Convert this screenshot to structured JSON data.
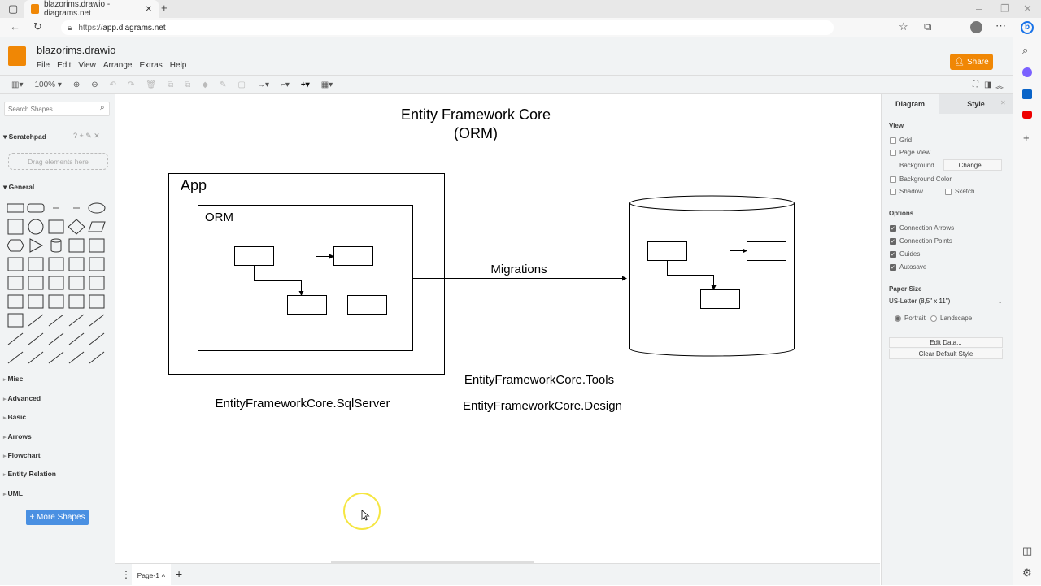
{
  "browser": {
    "tab_title": "blazorims.drawio - diagrams.net",
    "url_prefix": "https://",
    "url_host": "app.diagrams.net"
  },
  "app": {
    "title": "blazorims.drawio",
    "menu": [
      "File",
      "Edit",
      "View",
      "Arrange",
      "Extras",
      "Help"
    ],
    "share_label": "Share",
    "accent": "#f08705"
  },
  "toolbar": {
    "zoom": "100%"
  },
  "sidebar": {
    "search_placeholder": "Search Shapes",
    "scratchpad": "Scratchpad",
    "scratch_drop": "Drag elements here",
    "general": "General",
    "palette": [
      "rect",
      "rounded-rect",
      "text",
      "textbox",
      "ellipse",
      "square",
      "circle",
      "process",
      "diamond",
      "parallelogram",
      "hexagon",
      "triangle",
      "cylinder",
      "cloud",
      "document",
      "internal-storage",
      "cube",
      "step",
      "trapezoid",
      "tape",
      "note",
      "card",
      "callout",
      "actor",
      "or",
      "and",
      "data-storage",
      "square2",
      "tab",
      "frame",
      "list",
      "line-h",
      "curve",
      "bidir-arrow",
      "arrow",
      "dashed-line",
      "dotted-line",
      "line",
      "bidir-line",
      "directional-line",
      "thick-line",
      "arrow-line",
      "dash-arrow",
      "dash-line",
      "link"
    ],
    "categories": [
      "Misc",
      "Advanced",
      "Basic",
      "Arrows",
      "Flowchart",
      "Entity Relation",
      "UML"
    ],
    "more_shapes": "+ More Shapes"
  },
  "diagram": {
    "title_line1": "Entity Framework Core",
    "title_line2": "(ORM)",
    "app_label": "App",
    "orm_label": "ORM",
    "migrations": "Migrations",
    "sqlserver": "EntityFrameworkCore.SqlServer",
    "tools": "EntityFrameworkCore.Tools",
    "design": "EntityFrameworkCore.Design"
  },
  "pages": {
    "current": "Page-1"
  },
  "format_panel": {
    "tabs": [
      "Diagram",
      "Style"
    ],
    "view": "View",
    "grid": "Grid",
    "page_view": "Page View",
    "background": "Background",
    "change": "Change...",
    "background_color": "Background Color",
    "shadow": "Shadow",
    "sketch": "Sketch",
    "options": "Options",
    "connection_arrows": "Connection Arrows",
    "connection_points": "Connection Points",
    "guides": "Guides",
    "autosave": "Autosave",
    "paper_size": "Paper Size",
    "paper_value": "US-Letter (8,5\" x 11\")",
    "portrait": "Portrait",
    "landscape": "Landscape",
    "edit_data": "Edit Data...",
    "clear_style": "Clear Default Style"
  }
}
